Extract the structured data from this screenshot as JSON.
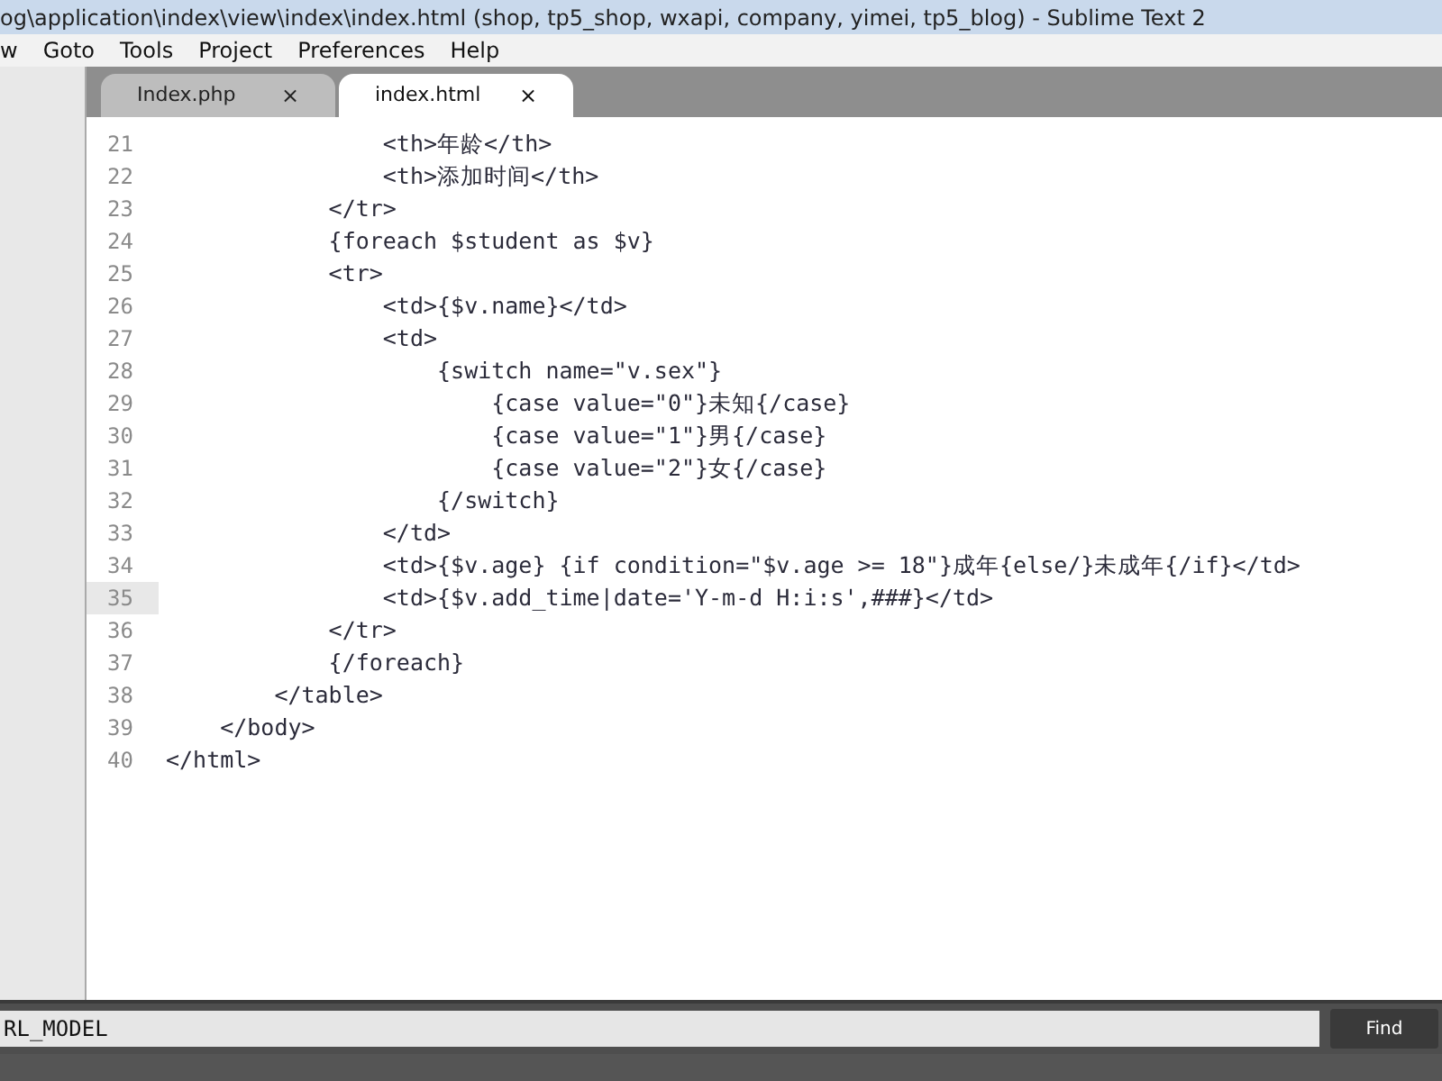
{
  "window": {
    "title": "og\\application\\index\\view\\index\\index.html (shop, tp5_shop, wxapi, company, yimei, tp5_blog) - Sublime Text 2"
  },
  "menu": [
    "w",
    "Goto",
    "Tools",
    "Project",
    "Preferences",
    "Help"
  ],
  "tabs": [
    {
      "label": "Index.php",
      "selected": false,
      "close": "×"
    },
    {
      "label": "index.html",
      "selected": true,
      "close": "×"
    }
  ],
  "editor": {
    "lines": [
      {
        "number": "21",
        "text": "                <th>年龄</th>",
        "current": false
      },
      {
        "number": "22",
        "text": "                <th>添加时间</th>",
        "current": false
      },
      {
        "number": "23",
        "text": "            </tr>",
        "current": false
      },
      {
        "number": "24",
        "text": "            {foreach $student as $v}",
        "current": false
      },
      {
        "number": "25",
        "text": "            <tr>",
        "current": false
      },
      {
        "number": "26",
        "text": "                <td>{$v.name}</td>",
        "current": false
      },
      {
        "number": "27",
        "text": "                <td>",
        "current": false
      },
      {
        "number": "28",
        "text": "                    {switch name=\"v.sex\"}",
        "current": false
      },
      {
        "number": "29",
        "text": "                        {case value=\"0\"}未知{/case}",
        "current": false
      },
      {
        "number": "30",
        "text": "                        {case value=\"1\"}男{/case}",
        "current": false
      },
      {
        "number": "31",
        "text": "                        {case value=\"2\"}女{/case}",
        "current": false
      },
      {
        "number": "32",
        "text": "                    {/switch}",
        "current": false
      },
      {
        "number": "33",
        "text": "                </td>",
        "current": false
      },
      {
        "number": "34",
        "text": "                <td>{$v.age} {if condition=\"$v.age >= 18\"}成年{else/}未成年{/if}</td>",
        "current": false
      },
      {
        "number": "35",
        "text": "                <td>{$v.add_time|date='Y-m-d H:i:s',###}</td>",
        "current": true
      },
      {
        "number": "36",
        "text": "            </tr>",
        "current": false
      },
      {
        "number": "37",
        "text": "            {/foreach}",
        "current": false
      },
      {
        "number": "38",
        "text": "        </table>",
        "current": false
      },
      {
        "number": "39",
        "text": "    </body>",
        "current": false
      },
      {
        "number": "40",
        "text": "</html>",
        "current": false
      }
    ]
  },
  "find_bar": {
    "value": "RL_MODEL",
    "button": "Find"
  }
}
